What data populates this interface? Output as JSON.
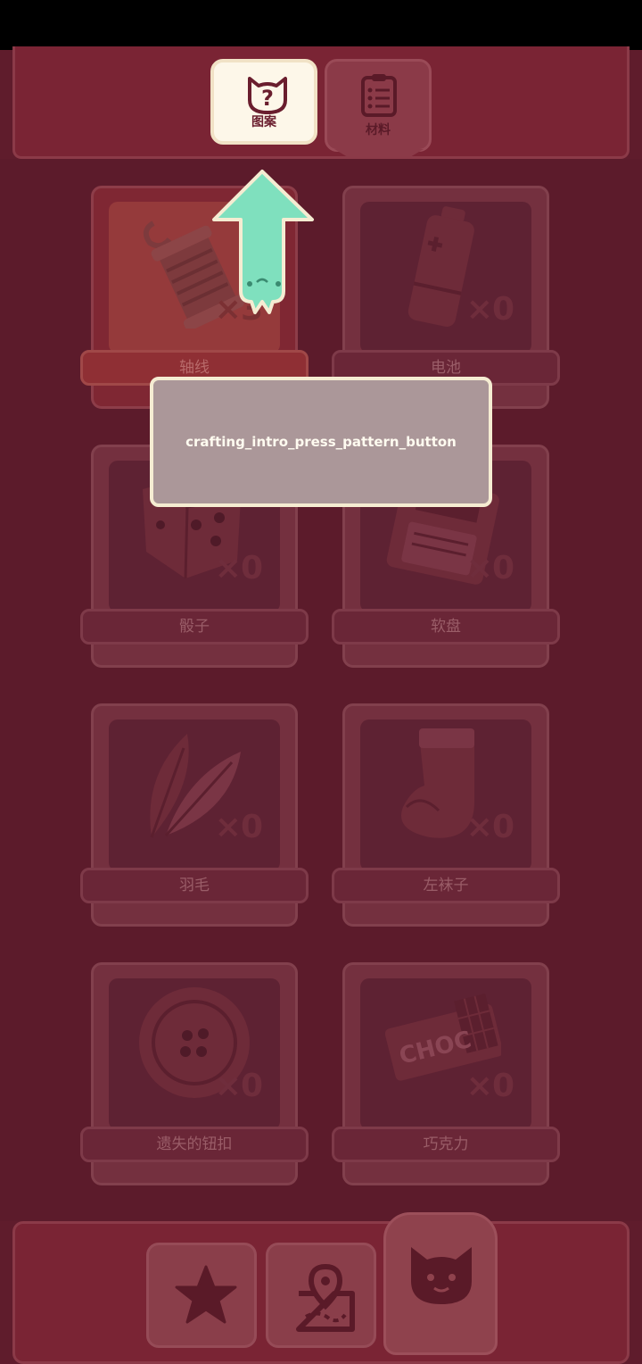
{
  "tabs": [
    {
      "label": "图案",
      "icon": "question-cat-icon",
      "active": true
    },
    {
      "label": "材料",
      "icon": "clipboard-icon",
      "active": false
    }
  ],
  "items": [
    {
      "label": "轴线",
      "count": "×3",
      "icon": "thread-spool-icon"
    },
    {
      "label": "电池",
      "count": "×0",
      "icon": "battery-icon"
    },
    {
      "label": "骰子",
      "count": "×0",
      "icon": "dice-icon"
    },
    {
      "label": "软盘",
      "count": "×0",
      "icon": "floppy-disk-icon"
    },
    {
      "label": "羽毛",
      "count": "×0",
      "icon": "feather-icon"
    },
    {
      "label": "左袜子",
      "count": "×0",
      "icon": "sock-icon"
    },
    {
      "label": "遗失的钮扣",
      "count": "×0",
      "icon": "button-icon"
    },
    {
      "label": "巧克力",
      "count": "×0",
      "icon": "chocolate-icon"
    }
  ],
  "chocolate_wrapper_text": "CHOC",
  "tutorial": {
    "message": "crafting_intro_press_pattern_button"
  },
  "bottom_nav": [
    {
      "icon": "star-icon"
    },
    {
      "icon": "map-pin-icon"
    },
    {
      "icon": "cat-face-icon"
    }
  ],
  "colors": {
    "pointer_arrow": "#7fe0be",
    "dialog_bg": "#ab9799",
    "background": "#5f1c2c"
  }
}
